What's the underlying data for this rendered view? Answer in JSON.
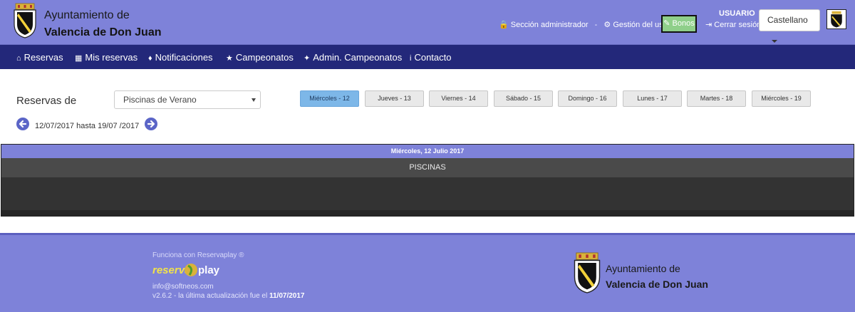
{
  "header": {
    "town_line1": "Ayuntamiento de",
    "town_line2": "Valencia de Don Juan",
    "links": {
      "admin": "Sección administrador",
      "user_mgmt": "Gestión del usuario",
      "bonos": "Bonos",
      "logout": "Cerrar sesión"
    },
    "username": "USUARIO",
    "language": "Castellano"
  },
  "nav": {
    "items": [
      {
        "label": "Reservas",
        "icon": "home-icon"
      },
      {
        "label": "Mis reservas",
        "icon": "calendar-icon"
      },
      {
        "label": "Notificaciones",
        "icon": "bell-icon"
      },
      {
        "label": "Campeonatos",
        "icon": "trophy-icon"
      },
      {
        "label": "Admin. Campeonatos",
        "icon": "wrench-icon"
      },
      {
        "label": "Contacto",
        "icon": "info-icon"
      }
    ]
  },
  "filters": {
    "label": "Reservas de",
    "facility": "Piscinas de Verano"
  },
  "days": [
    {
      "label": "Miércoles - 12",
      "active": true
    },
    {
      "label": "Jueves - 13",
      "active": false
    },
    {
      "label": "Viernes - 14",
      "active": false
    },
    {
      "label": "Sábado - 15",
      "active": false
    },
    {
      "label": "Domingo - 16",
      "active": false
    },
    {
      "label": "Lunes - 17",
      "active": false
    },
    {
      "label": "Martes - 18",
      "active": false
    },
    {
      "label": "Miércoles - 19",
      "active": false
    }
  ],
  "range": "12/07/2017 hasta 19/07 /2017",
  "schedule": {
    "date": "Miércoles, 12 Julio 2017",
    "column": "PISCINAS"
  },
  "footer": {
    "powered": "Funciona con Reservaplay ®",
    "brand_left": "reserva",
    "brand_right": "play",
    "email": "info@softneos.com",
    "version_prefix": "v2.6.2 - la última actualización fue el",
    "version_date": "11/07/2017",
    "town_line1": "Ayuntamiento de",
    "town_line2": "Valencia de Don Juan"
  },
  "colors": {
    "header": "#7e82d9",
    "nav": "#23287a",
    "active_day": "#7db7e8",
    "bonos": "#8fcf8a"
  }
}
